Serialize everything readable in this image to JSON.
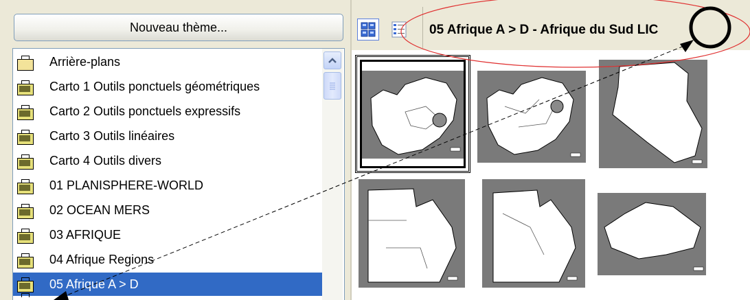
{
  "left_panel": {
    "new_theme_button": "Nouveau thème...",
    "items": [
      {
        "label": "Arrière-plans"
      },
      {
        "label": "Carto 1 Outils ponctuels géométriques"
      },
      {
        "label": "Carto 2 Outils ponctuels expressifs"
      },
      {
        "label": "Carto 3 Outils  linéaires"
      },
      {
        "label": "Carto 4 Outils divers"
      },
      {
        "label": "01 PLANISPHERE-WORLD"
      },
      {
        "label": "02 OCEAN MERS"
      },
      {
        "label": "03 AFRIQUE"
      },
      {
        "label": "04 Afrique Regions"
      },
      {
        "label": "05 Afrique A > D",
        "selected": true
      }
    ]
  },
  "toolbar": {
    "path": "05 Afrique A > D - Afrique du Sud LIC",
    "view_buttons": [
      {
        "name": "thumbnail-view-icon",
        "active": true
      },
      {
        "name": "list-view-icon",
        "active": false
      }
    ]
  },
  "gallery": {
    "thumbnails": [
      {
        "name": "map-thumb-south-africa-1",
        "selected": true
      },
      {
        "name": "map-thumb-south-africa-2"
      },
      {
        "name": "map-thumb-algeria"
      },
      {
        "name": "map-thumb-botswana-1"
      },
      {
        "name": "map-thumb-botswana-2"
      },
      {
        "name": "map-thumb-burkina-faso"
      }
    ]
  },
  "colors": {
    "selection": "#316ac5",
    "annotation_red": "#e03030",
    "panel_bg": "#ece9d8"
  }
}
